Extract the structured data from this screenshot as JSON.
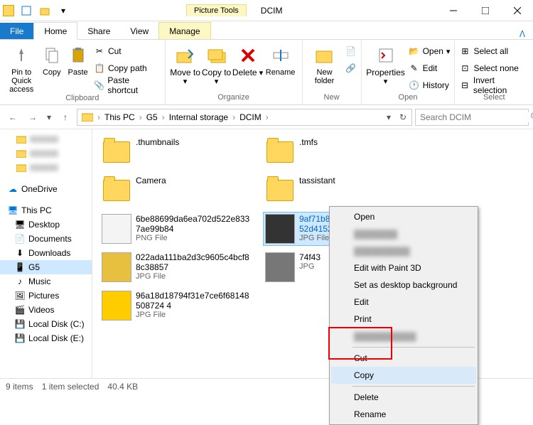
{
  "window": {
    "title": "DCIM",
    "picture_tools": "Picture Tools"
  },
  "tabs": {
    "file": "File",
    "home": "Home",
    "share": "Share",
    "view": "View",
    "manage": "Manage"
  },
  "ribbon": {
    "clipboard": {
      "label": "Clipboard",
      "pin": "Pin to Quick access",
      "copy": "Copy",
      "paste": "Paste",
      "cut": "Cut",
      "copypath": "Copy path",
      "pasteshortcut": "Paste shortcut"
    },
    "organize": {
      "label": "Organize",
      "moveto": "Move to",
      "copyto": "Copy to",
      "delete": "Delete",
      "rename": "Rename"
    },
    "new": {
      "label": "New",
      "newfolder": "New folder"
    },
    "open": {
      "label": "Open",
      "properties": "Properties",
      "open": "Open",
      "edit": "Edit",
      "history": "History"
    },
    "select": {
      "label": "Select",
      "selectall": "Select all",
      "selectnone": "Select none",
      "invert": "Invert selection"
    }
  },
  "breadcrumbs": [
    "This PC",
    "G5",
    "Internal storage",
    "DCIM"
  ],
  "search": {
    "placeholder": "Search DCIM"
  },
  "nav": {
    "onedrive": "OneDrive",
    "thispc": "This PC",
    "desktop": "Desktop",
    "documents": "Documents",
    "downloads": "Downloads",
    "g5": "G5",
    "music": "Music",
    "pictures": "Pictures",
    "videos": "Videos",
    "localdiskc": "Local Disk (C:)",
    "localdiske": "Local Disk (E:)"
  },
  "files": {
    "folders": [
      {
        "name": ".thumbnails"
      },
      {
        "name": ".tmfs"
      },
      {
        "name": "Camera"
      },
      {
        "name": "tassistant"
      }
    ],
    "items": [
      {
        "name": "6be88699da6ea702d522e8337ae99b84",
        "type": "PNG File"
      },
      {
        "name": "9af71b82d0a4075bb0461af7452d4152",
        "type": "JPG File"
      },
      {
        "name": "022ada111ba2d3c9605c4bcf88c38857",
        "type": "JPG File"
      },
      {
        "name": "74f43",
        "type": "JPG"
      },
      {
        "name": "96a18d18794f31e7ce6f68148508724 4",
        "type": "JPG File"
      }
    ]
  },
  "contextmenu": {
    "open": "Open",
    "editpaint3d": "Edit with Paint 3D",
    "setbg": "Set as desktop background",
    "edit": "Edit",
    "print": "Print",
    "cut": "Cut",
    "copy": "Copy",
    "delete": "Delete",
    "rename": "Rename"
  },
  "statusbar": {
    "count": "9 items",
    "selected": "1 item selected",
    "size": "40.4 KB"
  }
}
